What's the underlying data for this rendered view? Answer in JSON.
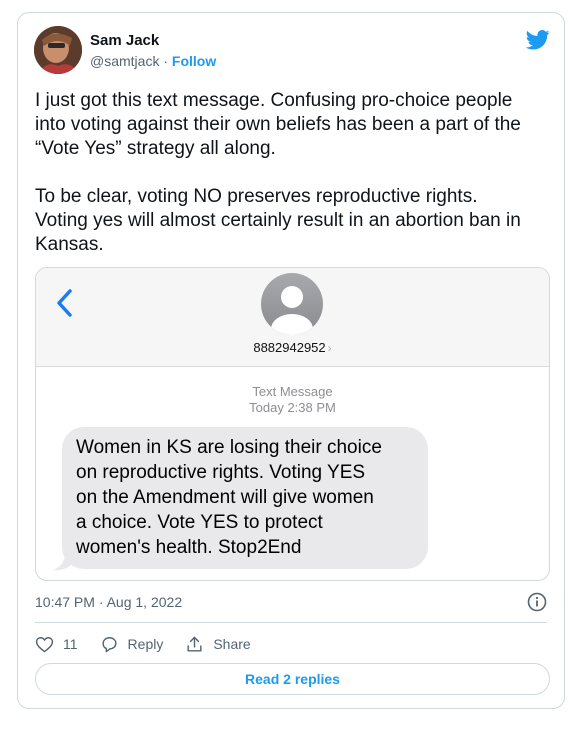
{
  "author": {
    "name": "Sam Jack",
    "handle": "@samtjack",
    "separator": "·",
    "follow_label": "Follow"
  },
  "tweet": {
    "text": "I just got this text message. Confusing pro-choice people\ninto voting against their own beliefs has been a part of the\n“Vote Yes” strategy all along.\n\nTo be clear, voting NO preserves reproductive rights.\nVoting yes will almost certainly result in an abortion ban in\nKansas."
  },
  "sms": {
    "contact_number": "8882942952",
    "contact_chevron": "›",
    "meta_title": "Text Message",
    "meta_time": "Today 2:38 PM",
    "bubble_text": "Women in KS are losing their choice\non reproductive rights. Voting YES\non the Amendment will give women\na choice. Vote YES to protect\nwomen's health. Stop2End"
  },
  "footer": {
    "timestamp": "10:47 PM · Aug 1, 2022",
    "like_count": "11",
    "reply_label": "Reply",
    "share_label": "Share",
    "read_replies_label": "Read 2 replies"
  },
  "icons": {
    "bird": "twitter-bird-icon",
    "info": "info-icon",
    "like": "heart-icon",
    "reply": "speech-bubble-icon",
    "share": "share-upload-icon",
    "back": "chevron-left-icon",
    "contact": "person-icon"
  },
  "colors": {
    "accent": "#1d9bf0",
    "text": "#0f1419",
    "muted": "#536471",
    "border": "#cfd9de",
    "bubble": "#e9e9eb",
    "ios_blue": "#1a7cf5"
  }
}
